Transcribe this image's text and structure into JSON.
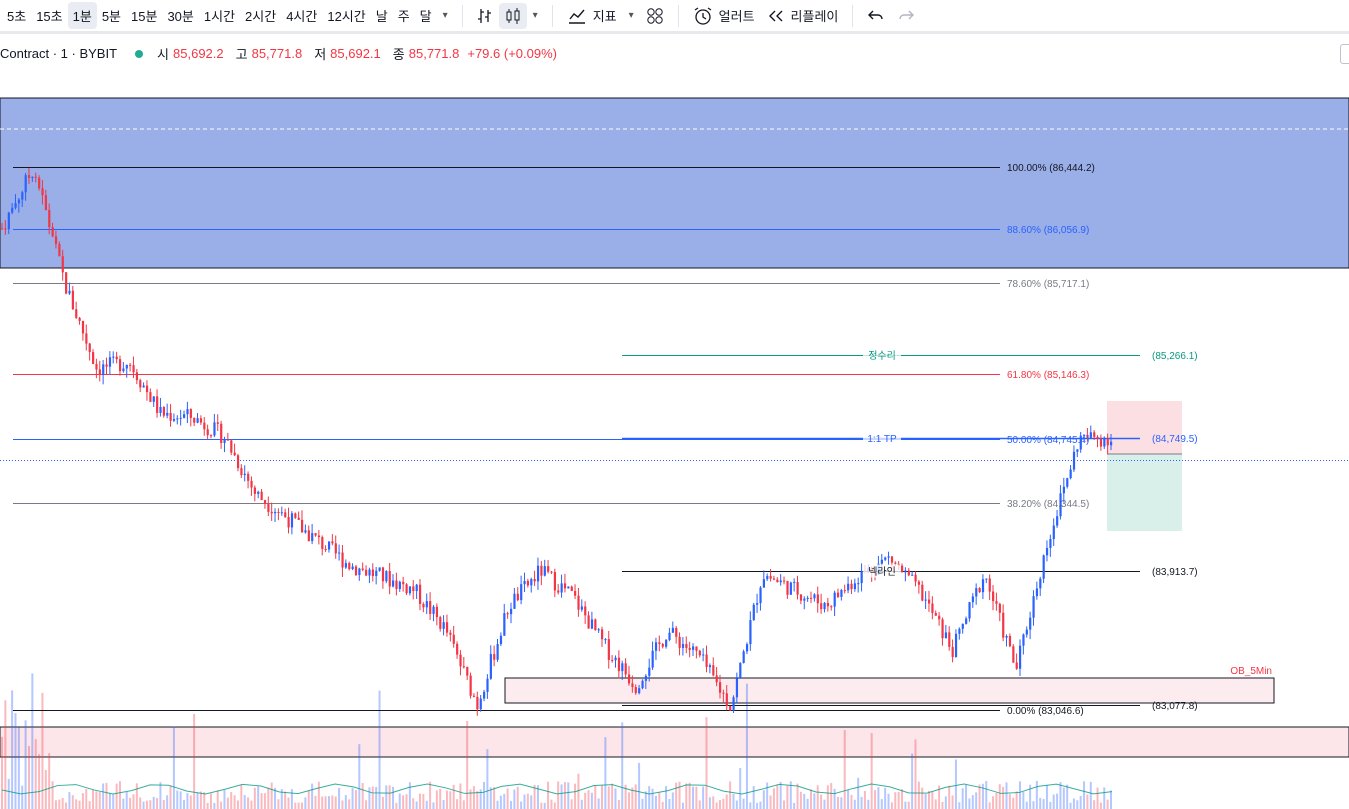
{
  "toolbar": {
    "timeframes": [
      "5초",
      "15초",
      "1분",
      "5분",
      "15분",
      "30분",
      "1시간",
      "2시간",
      "4시간",
      "12시간",
      "날",
      "주",
      "달"
    ],
    "active_timeframe": "1분",
    "indicators_label": "지표",
    "alert_label": "얼러트",
    "replay_label": "리플레이"
  },
  "legend": {
    "symbol": "Contract · 1 · BYBIT",
    "open_label": "시",
    "open": "85,692.2",
    "high_label": "고",
    "high": "85,771.8",
    "low_label": "저",
    "low": "85,692.1",
    "close_label": "종",
    "close": "85,771.8",
    "change": "+79.6 (+0.09%)"
  },
  "chart_data": {
    "type": "candlestick",
    "symbol": "Contract · 1 · BYBIT",
    "timeframe": "1분",
    "fib_levels": [
      {
        "label": "100.00% (86,444.2)",
        "ratio": 1.0,
        "price": 86444.2,
        "color": "#131722"
      },
      {
        "label": "88.60% (86,056.9)",
        "ratio": 0.886,
        "price": 86056.9,
        "color": "#2962ff"
      },
      {
        "label": "78.60% (85,717.1)",
        "ratio": 0.786,
        "price": 85717.1,
        "color": "#787b86"
      },
      {
        "label": "61.80% (85,146.3)",
        "ratio": 0.618,
        "price": 85146.3,
        "color": "#f23645"
      },
      {
        "label": "50.00% (84,745.4)",
        "ratio": 0.5,
        "price": 84745.4,
        "color": "#2962ff"
      },
      {
        "label": "38.20% (84,344.5)",
        "ratio": 0.382,
        "price": 84344.5,
        "color": "#787b86"
      },
      {
        "label": "0.00% (83,046.6)",
        "ratio": 0.0,
        "price": 83046.6,
        "color": "#131722"
      }
    ],
    "horizontal_lines": [
      {
        "label": "정수리",
        "value": "(85,266.1)",
        "price": 85266.1,
        "color": "#089981"
      },
      {
        "label": "1:1 TP",
        "value": "(84,749.5)",
        "price": 84749.5,
        "color": "#2962ff"
      },
      {
        "label": "넥라인",
        "value": "(83,913.7)",
        "price": 83913.7,
        "color": "#131722"
      },
      {
        "label": "",
        "value": "(83,077.8)",
        "price": 83077.8,
        "color": "#131722"
      }
    ],
    "zones": [
      {
        "label": "OB_5Min",
        "color": "#f23645"
      }
    ],
    "price_path": [
      86060,
      86444,
      85700,
      85180,
      85230,
      84900,
      84880,
      84760,
      84400,
      84250,
      84100,
      83950,
      83880,
      83800,
      83550,
      83080,
      83700,
      83920,
      83760,
      83450,
      83200,
      83540,
      83380,
      83070,
      83900,
      83800,
      83700,
      83880,
      84000,
      83780,
      83420,
      83900,
      83300,
      84100,
      84750,
      84745
    ]
  }
}
